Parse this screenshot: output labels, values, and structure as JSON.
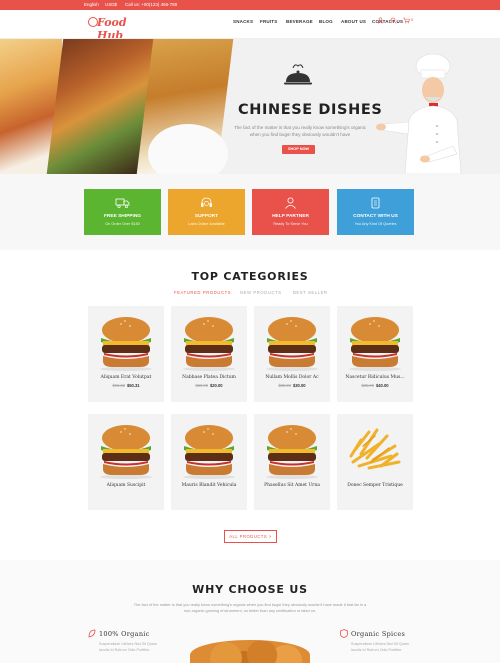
{
  "topbar": {
    "language": "English",
    "currency": "USD$",
    "call_label": "Call us: +00(123) 456-789",
    "logo_text": "Food Hub",
    "cart_count": "0"
  },
  "nav": {
    "items": [
      "SNACKS",
      "FRUITS",
      "BEVERAGE",
      "BLOG",
      "ABOUT US",
      "CONTACT US"
    ]
  },
  "hero": {
    "title": "CHINESE DISHES",
    "description": "The fact of the matter is that you really know something's organic when you find bugs! they obviously wouldn't have",
    "button": "SHOP NOW"
  },
  "services": [
    {
      "title": "Free Shipping",
      "subtitle": "On Order Over $150",
      "color": "#5bb530",
      "icon": "truck-icon"
    },
    {
      "title": "Support",
      "subtitle": "Labs Online Available",
      "color": "#eca52d",
      "icon": "headset-icon"
    },
    {
      "title": "Help Partner",
      "subtitle": "Ready To Serve You",
      "color": "#e8524a",
      "icon": "user-icon"
    },
    {
      "title": "Contact With Us",
      "subtitle": "You Any Kind Of Queries",
      "color": "#3f9fd8",
      "icon": "phone-icon"
    }
  ],
  "categories": {
    "title": "TOP CATEGORIES",
    "tabs": [
      "FEATURED PRODUCTS",
      "NEW PRODUCTS",
      "BEST SELLER"
    ],
    "products": [
      {
        "name": "Aliquam Erat Volutpat",
        "old_price": "$55.32",
        "price": "$50.31",
        "image": "burger"
      },
      {
        "name": "Nabbase Platea Dictum",
        "old_price": "$30.00",
        "price": "$20.00",
        "image": "burger"
      },
      {
        "name": "Nullam Mollis Dolor Ac",
        "old_price": "$30.00",
        "price": "$30.00",
        "image": "burger"
      },
      {
        "name": "Nascetur Ridiculus Mus...",
        "old_price": "$35.00",
        "price": "$40.00",
        "image": "burger"
      },
      {
        "name": "Aliquam Suscipit",
        "old_price": "",
        "price": "",
        "image": "burger"
      },
      {
        "name": "Mauris Blandit Vehicula",
        "old_price": "",
        "price": "",
        "image": "burger"
      },
      {
        "name": "Phasellus Sit Amet Urna",
        "old_price": "",
        "price": "",
        "image": "burger"
      },
      {
        "name": "Donec Semper Tristique",
        "old_price": "",
        "price": "",
        "image": "fries"
      }
    ],
    "all_button": "ALL PRODUCTS >"
  },
  "why": {
    "title": "WHY CHOOSE US",
    "description": "The fact of the matter is that you really know something's organic when you find bugs! they obviously wouldn't have made it that far in a non-organic growing environment, so better than any certification or label on.",
    "features": [
      {
        "title": "100% Organic",
        "description": "Suspendisse Ultrices Nisl Sit Quam Iaculis Id Rutrum Odio Porttitor."
      },
      {
        "title": "Organic Spices",
        "description": "Suspendisse Ultrices Nisl Sit Quam Iaculis Id Rutrum Odio Porttitor."
      }
    ]
  },
  "colors": {
    "accent": "#e8524a"
  }
}
